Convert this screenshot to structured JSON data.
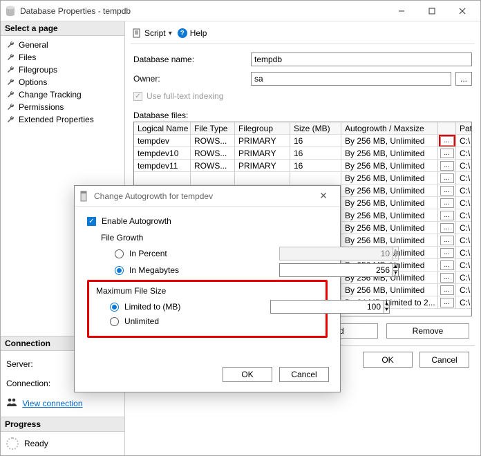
{
  "window": {
    "title": "Database Properties - tempdb"
  },
  "sidebar": {
    "select_header": "Select a page",
    "pages": [
      "General",
      "Files",
      "Filegroups",
      "Options",
      "Change Tracking",
      "Permissions",
      "Extended Properties"
    ],
    "connection_header": "Connection",
    "server_label": "Server:",
    "connection_label": "Connection:",
    "view_link": "View connection",
    "progress_header": "Progress",
    "progress_status": "Ready"
  },
  "toolbar": {
    "script": "Script",
    "help": "Help"
  },
  "form": {
    "dbname_label": "Database name:",
    "dbname_value": "tempdb",
    "owner_label": "Owner:",
    "owner_value": "sa",
    "fti_label": "Use full-text indexing",
    "files_label": "Database files:"
  },
  "grid": {
    "headers": [
      "Logical Name",
      "File Type",
      "Filegroup",
      "Size (MB)",
      "Autogrowth / Maxsize",
      "",
      "Path"
    ],
    "rows": [
      {
        "name": "tempdev",
        "ft": "ROWS...",
        "fg": "PRIMARY",
        "sz": "16",
        "ag": "By 256 MB, Unlimited",
        "path": "C:\\",
        "hl": true
      },
      {
        "name": "tempdev10",
        "ft": "ROWS...",
        "fg": "PRIMARY",
        "sz": "16",
        "ag": "By 256 MB, Unlimited",
        "path": "C:\\"
      },
      {
        "name": "tempdev11",
        "ft": "ROWS...",
        "fg": "PRIMARY",
        "sz": "16",
        "ag": "By 256 MB, Unlimited",
        "path": "C:\\"
      },
      {
        "name": "",
        "ft": "",
        "fg": "",
        "sz": "",
        "ag": "By 256 MB, Unlimited",
        "path": "C:\\"
      },
      {
        "name": "",
        "ft": "",
        "fg": "",
        "sz": "",
        "ag": "By 256 MB, Unlimited",
        "path": "C:\\"
      },
      {
        "name": "",
        "ft": "",
        "fg": "",
        "sz": "",
        "ag": "By 256 MB, Unlimited",
        "path": "C:\\"
      },
      {
        "name": "",
        "ft": "",
        "fg": "",
        "sz": "",
        "ag": "By 256 MB, Unlimited",
        "path": "C:\\"
      },
      {
        "name": "",
        "ft": "",
        "fg": "",
        "sz": "",
        "ag": "By 256 MB, Unlimited",
        "path": "C:\\"
      },
      {
        "name": "",
        "ft": "",
        "fg": "",
        "sz": "",
        "ag": "By 256 MB, Unlimited",
        "path": "C:\\"
      },
      {
        "name": "",
        "ft": "",
        "fg": "",
        "sz": "",
        "ag": "By 256 MB, Unlimited",
        "path": "C:\\"
      },
      {
        "name": "",
        "ft": "",
        "fg": "",
        "sz": "",
        "ag": "By 256 MB, Unlimited",
        "path": "C:\\"
      },
      {
        "name": "",
        "ft": "",
        "fg": "",
        "sz": "",
        "ag": "By 256 MB, Unlimited",
        "path": "C:\\"
      },
      {
        "name": "",
        "ft": "",
        "fg": "",
        "sz": "",
        "ag": "By 256 MB, Unlimited",
        "path": "C:\\"
      },
      {
        "name": "",
        "ft": "",
        "fg": "",
        "sz": "",
        "ag": "By 64 MB, Limited to 2...",
        "path": "C:\\"
      }
    ]
  },
  "buttons": {
    "add": "Add",
    "remove": "Remove",
    "ok": "OK",
    "cancel": "Cancel"
  },
  "dialog": {
    "title": "Change Autogrowth for tempdev",
    "enable": "Enable Autogrowth",
    "filegrowth": "File Growth",
    "in_percent": "In Percent",
    "in_megabytes": "In Megabytes",
    "percent_value": "10",
    "mb_value": "256",
    "maxsize": "Maximum File Size",
    "limited_to": "Limited to (MB)",
    "unlimited": "Unlimited",
    "limited_value": "100",
    "ok": "OK",
    "cancel": "Cancel"
  }
}
